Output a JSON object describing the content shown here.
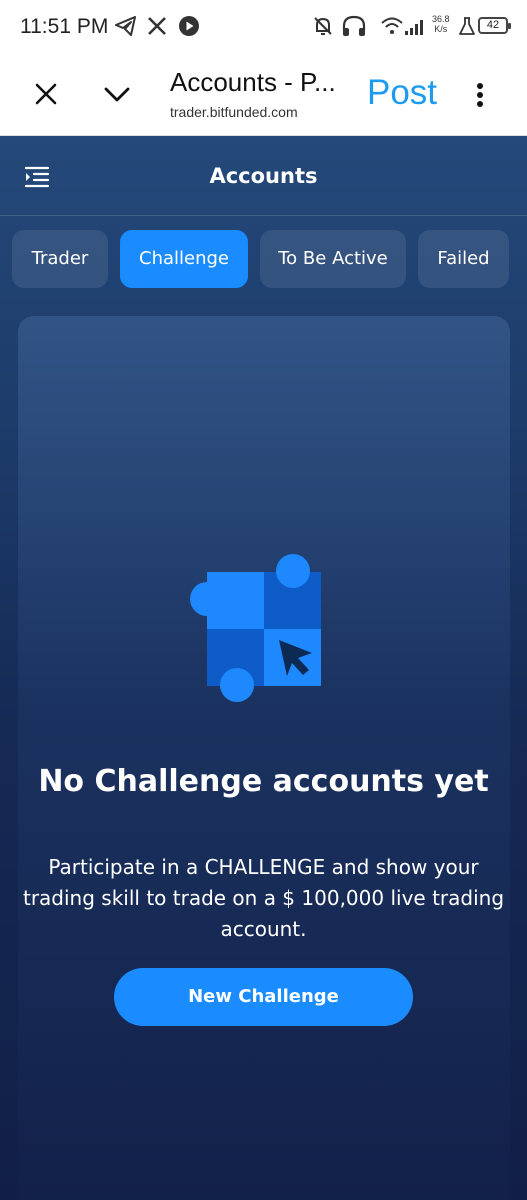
{
  "status_bar": {
    "time": "11:51 PM",
    "net_speed_value": "36.8",
    "net_speed_unit": "K/s",
    "battery": "42"
  },
  "browser": {
    "page_title": "Accounts - P...",
    "url": "trader.bitfunded.com",
    "post_label": "Post"
  },
  "app": {
    "title": "Accounts",
    "tabs": [
      {
        "label": "Trader",
        "active": false
      },
      {
        "label": "Challenge",
        "active": true
      },
      {
        "label": "To Be Active",
        "active": false
      },
      {
        "label": "Failed",
        "active": false
      }
    ],
    "empty_state": {
      "title": "No Challenge accounts yet",
      "description": "Participate in a CHALLENGE and show your trading skill to trade on a $ 100,000 live trading account.",
      "button_label": "New Challenge"
    }
  },
  "colors": {
    "accent": "#1a8cff",
    "post_link": "#1d9bf0"
  }
}
